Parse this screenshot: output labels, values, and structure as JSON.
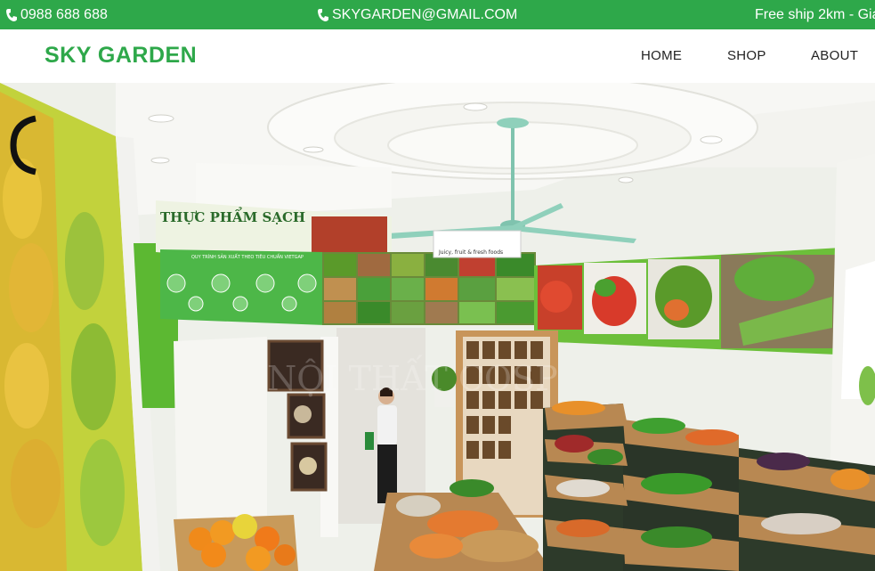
{
  "topbar": {
    "phone": "0988 688 688",
    "email": "SKYGARDEN@GMAIL.COM",
    "shipping": "Free ship 2km - Gia"
  },
  "header": {
    "brand": "SKY GARDEN",
    "nav": [
      "HOME",
      "SHOP",
      "ABOUT"
    ]
  },
  "hero": {
    "banner_title": "THỰC PHẨM SẠCH",
    "process_title": "QUY TRÌNH SẢN XUẤT THEO TIÊU CHUẨN VIETGAP",
    "shop_sign": "Juicy, fruit & fresh foods",
    "watermark": "NỘI THẤT COSP"
  },
  "colors": {
    "accent": "#2ea84a",
    "topbar_text": "#ffffff",
    "nav_text": "#222222"
  }
}
